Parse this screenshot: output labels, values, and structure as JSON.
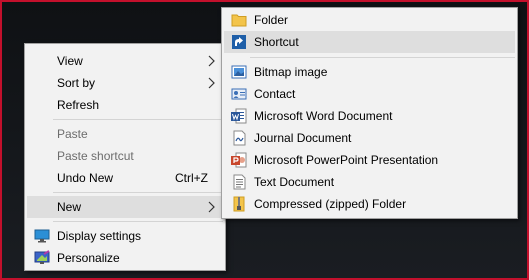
{
  "context_menu": {
    "items": [
      {
        "label": "View"
      },
      {
        "label": "Sort by"
      },
      {
        "label": "Refresh"
      },
      {
        "label": "Paste"
      },
      {
        "label": "Paste shortcut"
      },
      {
        "label": "Undo New",
        "shortcut": "Ctrl+Z"
      },
      {
        "label": "New"
      },
      {
        "label": "Display settings"
      },
      {
        "label": "Personalize"
      }
    ]
  },
  "new_submenu": {
    "items": [
      {
        "label": "Folder",
        "icon": "folder-icon"
      },
      {
        "label": "Shortcut",
        "icon": "shortcut-icon"
      },
      {
        "label": "Bitmap image",
        "icon": "bitmap-icon"
      },
      {
        "label": "Contact",
        "icon": "contact-icon"
      },
      {
        "label": "Microsoft Word Document",
        "icon": "word-document-icon"
      },
      {
        "label": "Journal Document",
        "icon": "journal-document-icon"
      },
      {
        "label": "Microsoft PowerPoint Presentation",
        "icon": "powerpoint-icon"
      },
      {
        "label": "Text Document",
        "icon": "text-document-icon"
      },
      {
        "label": "Compressed (zipped) Folder",
        "icon": "zip-folder-icon"
      }
    ]
  },
  "colors": {
    "desktop_border": "#c3102c",
    "desktop": "#14171b",
    "menu_background": "#f2f2f2",
    "hover_background": "#dedede",
    "disabled_text": "#6d6d6d"
  }
}
